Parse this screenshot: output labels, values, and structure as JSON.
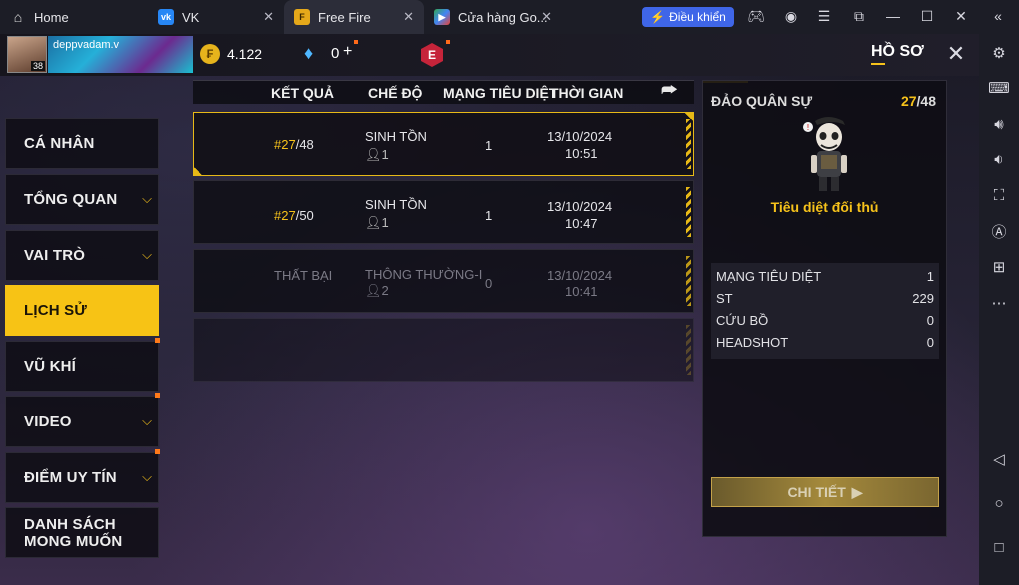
{
  "browser": {
    "tabs": [
      {
        "label": "Home",
        "icon": "home-icon"
      },
      {
        "label": "VK",
        "icon": "vk-logo-icon"
      },
      {
        "label": "Free Fire",
        "icon": "free-fire-icon"
      },
      {
        "label": "Cửa hàng Go...",
        "icon": "google-play-icon"
      }
    ],
    "control_button": "Điều khiển"
  },
  "player": {
    "username": "deppvadam.v",
    "level": "38"
  },
  "currency": {
    "coins": "4.122",
    "diamonds": "0",
    "diamond_plus": "+",
    "event_badge": "E"
  },
  "header": {
    "title": "HỒ SƠ"
  },
  "menu": [
    {
      "label": "CÁ NHÂN",
      "chevron": false,
      "notify": false,
      "active": false
    },
    {
      "label": "TỔNG QUAN",
      "chevron": true,
      "notify": false,
      "active": false
    },
    {
      "label": "VAI TRÒ",
      "chevron": true,
      "notify": false,
      "active": false
    },
    {
      "label": "LỊCH SỬ",
      "chevron": false,
      "notify": false,
      "active": true
    },
    {
      "label": "VŨ KHÍ",
      "chevron": false,
      "notify": true,
      "active": false
    },
    {
      "label": "VIDEO",
      "chevron": true,
      "notify": true,
      "active": false
    },
    {
      "label": "ĐIỂM UY TÍN",
      "chevron": true,
      "notify": true,
      "active": false
    },
    {
      "label": "DANH SÁCH MONG MUỐN",
      "chevron": false,
      "notify": false,
      "active": false
    }
  ],
  "table": {
    "headers": [
      "KẾT QUẢ",
      "CHẾ ĐỘ",
      "MẠNG TIÊU DIỆT",
      "THỜI GIAN"
    ],
    "rows": [
      {
        "rank": "#27",
        "total": "/48",
        "mode": "SINH TỒN",
        "players": "1",
        "kills": "1",
        "date": "13/10/2024",
        "time": "10:51"
      },
      {
        "rank": "#27",
        "total": "/50",
        "mode": "SINH TỒN",
        "players": "1",
        "kills": "1",
        "date": "13/10/2024",
        "time": "10:47"
      },
      {
        "result": "THẤT BẠI",
        "mode": "THÔNG THƯỜNG-I",
        "players": "2",
        "kills": "0",
        "date": "13/10/2024",
        "time": "10:41"
      }
    ]
  },
  "detail": {
    "map": "ĐẢO QUÂN SỰ",
    "rank": "27",
    "total": "/48",
    "achievement": "Tiêu diệt đối thủ",
    "stats": [
      {
        "label": "MẠNG TIÊU DIỆT",
        "value": "1"
      },
      {
        "label": "ST",
        "value": "229"
      },
      {
        "label": "CỨU BỒ",
        "value": "0"
      },
      {
        "label": "HEADSHOT",
        "value": "0"
      }
    ],
    "button": "CHI TIẾT"
  },
  "colors": {
    "accent": "#f7c315",
    "emulator_control": "#3f66e8",
    "notify": "#ff7a1a"
  }
}
